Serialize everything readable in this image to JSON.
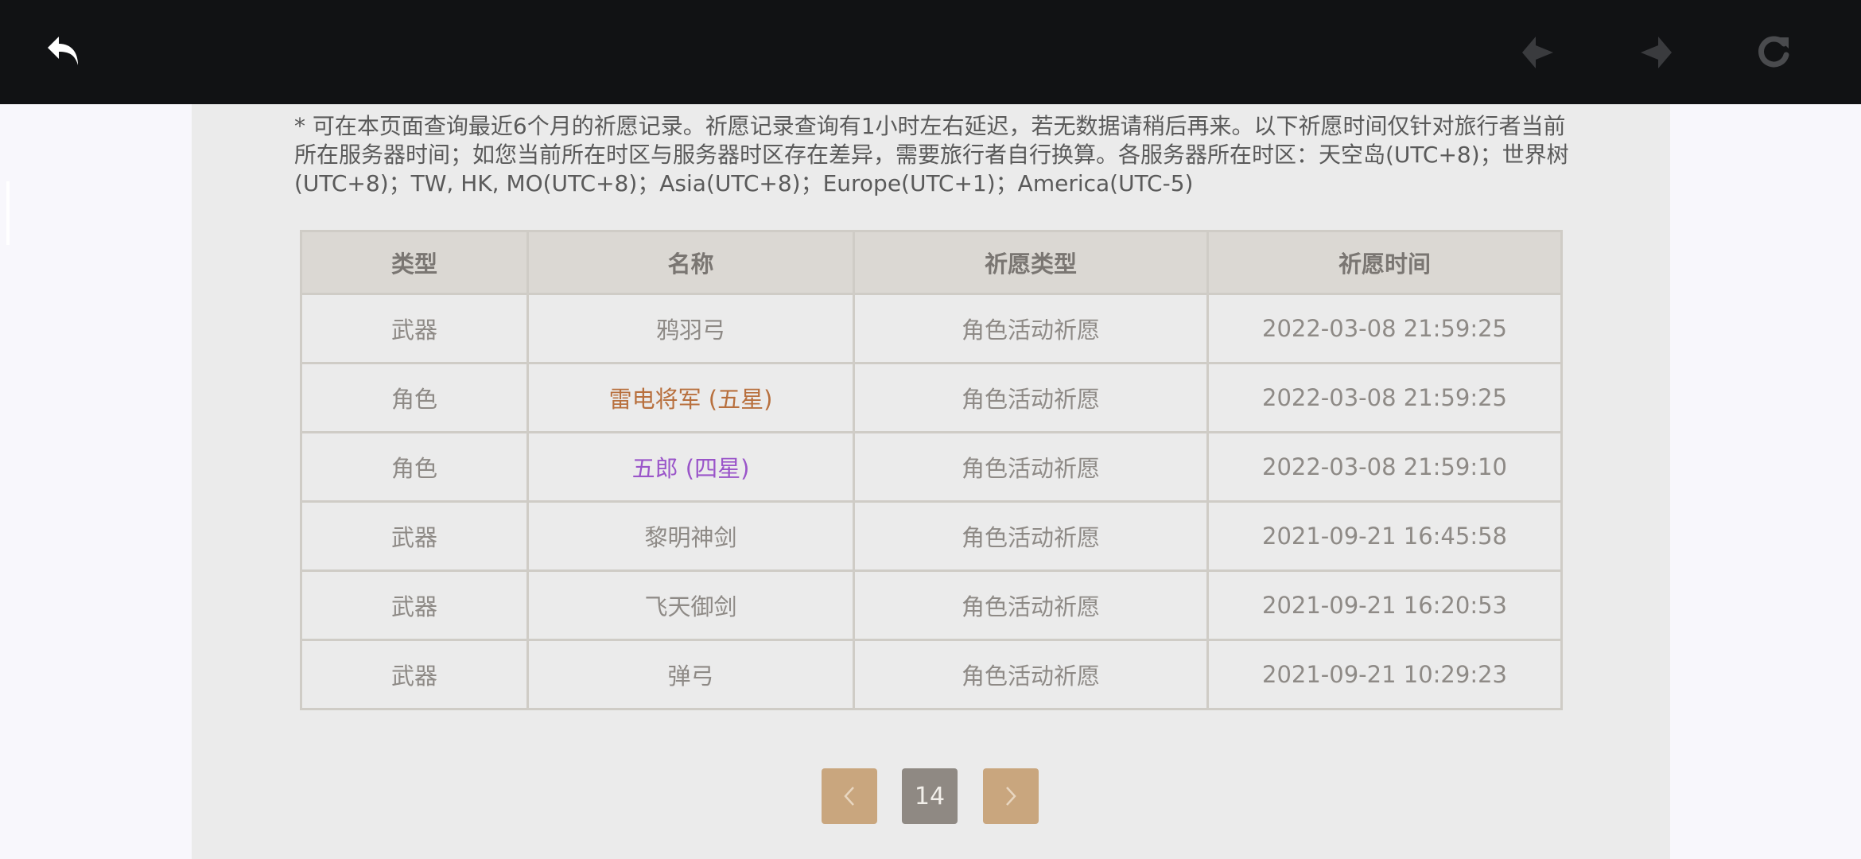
{
  "colors": {
    "topbar": "#111214",
    "panel": "#ebebeb",
    "table_header": "#dbd8d3",
    "five_star": "#b8703e",
    "four_star": "#9a55c9",
    "pager_arrow": "#c9a67e",
    "pager_page": "#8f8983"
  },
  "toolbar": {
    "back_icon": "undo-arrow",
    "nav_back_icon": "diamond-arrow-left",
    "nav_forward_icon": "diamond-arrow-right",
    "refresh_icon": "refresh"
  },
  "notice": "* 可在本页面查询最近6个月的祈愿记录。祈愿记录查询有1小时左右延迟，若无数据请稍后再来。以下祈愿时间仅针对旅行者当前所在服务器时间；如您当前所在时区与服务器时区存在差异，需要旅行者自行换算。各服务器所在时区：天空岛(UTC+8)；世界树(UTC+8)；TW, HK, MO(UTC+8)；Asia(UTC+8)；Europe(UTC+1)；America(UTC-5)",
  "table": {
    "headers": [
      "类型",
      "名称",
      "祈愿类型",
      "祈愿时间"
    ],
    "rows": [
      {
        "type": "武器",
        "name": "鸦羽弓",
        "wish": "角色活动祈愿",
        "time": "2022-03-08 21:59:25",
        "rarity": "normal"
      },
      {
        "type": "角色",
        "name": "雷电将军 (五星)",
        "wish": "角色活动祈愿",
        "time": "2022-03-08 21:59:25",
        "rarity": "five"
      },
      {
        "type": "角色",
        "name": "五郎 (四星)",
        "wish": "角色活动祈愿",
        "time": "2022-03-08 21:59:10",
        "rarity": "four"
      },
      {
        "type": "武器",
        "name": "黎明神剑",
        "wish": "角色活动祈愿",
        "time": "2021-09-21 16:45:58",
        "rarity": "normal"
      },
      {
        "type": "武器",
        "name": "飞天御剑",
        "wish": "角色活动祈愿",
        "time": "2021-09-21 16:20:53",
        "rarity": "normal"
      },
      {
        "type": "武器",
        "name": "弹弓",
        "wish": "角色活动祈愿",
        "time": "2021-09-21 10:29:23",
        "rarity": "normal"
      }
    ]
  },
  "pagination": {
    "prev_icon": "chevron-left",
    "current_page": "14",
    "next_icon": "chevron-right"
  }
}
